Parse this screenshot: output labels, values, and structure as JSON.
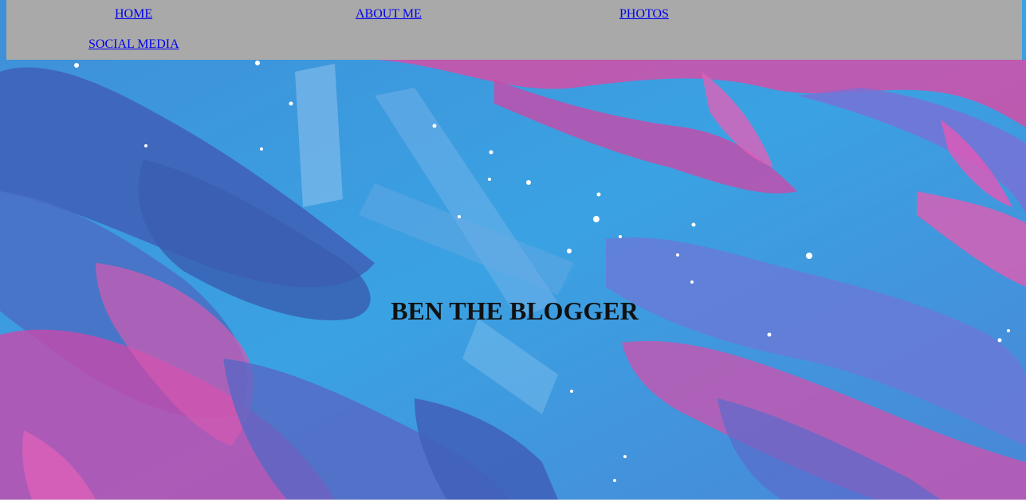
{
  "nav": {
    "home": "HOME",
    "about": "ABOUT ME",
    "photos": "PHOTOS",
    "social": "SOCIAL MEDIA"
  },
  "hero": {
    "title": "BEN THE BLOGGER"
  },
  "colors": {
    "navbar_bg": "#a9a9a9",
    "link": "#0000ee",
    "title": "#111111",
    "sky_blue": "#3a9ad9",
    "magenta": "#d64fb0",
    "violet": "#6a6fd0",
    "deep_blue": "#3f5fb8"
  }
}
